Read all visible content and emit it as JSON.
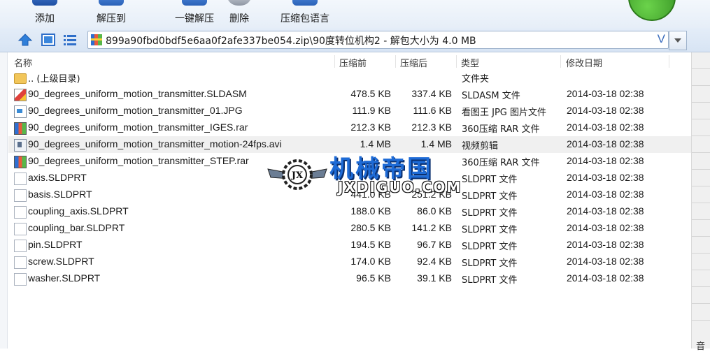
{
  "toolbar": {
    "add_label": "添加",
    "extract_to_label": "解压到",
    "one_click_extract_label": "一键解压",
    "delete_label": "删除",
    "language_pack_label": "压缩包语言"
  },
  "address_bar": {
    "path": "899a90fbd0bdf5e6aa0f2afe337be054.zip\\90度转位机构2 - 解包大小为 4.0 MB",
    "v_marker": "V"
  },
  "columns": {
    "name": "名称",
    "compressed": "压缩前",
    "original": "压缩后",
    "type": "类型",
    "modified": "修改日期"
  },
  "parent_folder": {
    "name": ".. (上级目录)",
    "type": "文件夹"
  },
  "files": [
    {
      "name": "90_degrees_uniform_motion_transmitter.SLDASM",
      "compressed": "478.5 KB",
      "original": "337.4 KB",
      "type": "SLDASM 文件",
      "date": "2014-03-18 02:38",
      "icon": "solidworks-assembly-icon"
    },
    {
      "name": "90_degrees_uniform_motion_transmitter_01.JPG",
      "compressed": "111.9 KB",
      "original": "111.6 KB",
      "type": "看图王 JPG 图片文件",
      "date": "2014-03-18 02:38",
      "icon": "jpg-image-icon"
    },
    {
      "name": "90_degrees_uniform_motion_transmitter_IGES.rar",
      "compressed": "212.3 KB",
      "original": "212.3 KB",
      "type": "360压缩 RAR 文件",
      "date": "2014-03-18 02:38",
      "icon": "rar-archive-icon"
    },
    {
      "name": "90_degrees_uniform_motion_transmitter_motion-24fps.avi",
      "compressed": "1.4 MB",
      "original": "1.4 MB",
      "type": "视频剪辑",
      "date": "2014-03-18 02:38",
      "icon": "video-file-icon"
    },
    {
      "name": "90_degrees_uniform_motion_transmitter_STEP.rar",
      "compressed": "",
      "original": "",
      "type": "360压缩 RAR 文件",
      "date": "2014-03-18 02:38",
      "icon": "rar-archive-icon"
    },
    {
      "name": "axis.SLDPRT",
      "compressed": "",
      "original": "",
      "type": "SLDPRT 文件",
      "date": "2014-03-18 02:38",
      "icon": "part-file-icon"
    },
    {
      "name": "basis.SLDPRT",
      "compressed": "441.0 KB",
      "original": "251.2 KB",
      "type": "SLDPRT 文件",
      "date": "2014-03-18 02:38",
      "icon": "part-file-icon"
    },
    {
      "name": "coupling_axis.SLDPRT",
      "compressed": "188.0 KB",
      "original": "86.0 KB",
      "type": "SLDPRT 文件",
      "date": "2014-03-18 02:38",
      "icon": "part-file-icon"
    },
    {
      "name": "coupling_bar.SLDPRT",
      "compressed": "280.5 KB",
      "original": "141.2 KB",
      "type": "SLDPRT 文件",
      "date": "2014-03-18 02:38",
      "icon": "part-file-icon"
    },
    {
      "name": "pin.SLDPRT",
      "compressed": "194.5 KB",
      "original": "96.7 KB",
      "type": "SLDPRT 文件",
      "date": "2014-03-18 02:38",
      "icon": "part-file-icon"
    },
    {
      "name": "screw.SLDPRT",
      "compressed": "174.0 KB",
      "original": "92.4 KB",
      "type": "SLDPRT 文件",
      "date": "2014-03-18 02:38",
      "icon": "part-file-icon"
    },
    {
      "name": "washer.SLDPRT",
      "compressed": "96.5 KB",
      "original": "39.1 KB",
      "type": "SLDPRT 文件",
      "date": "2014-03-18 02:38",
      "icon": "part-file-icon"
    }
  ],
  "watermark": {
    "title": "机械帝国",
    "subtitle": "JXDIGUO.COM",
    "seal_text": "JX"
  },
  "right_edge_text": "音",
  "colors": {
    "selected_row": "#f0f0f0",
    "watermark_blue": "#1e6bd6",
    "toolbar_bg": "#e6eef8"
  }
}
